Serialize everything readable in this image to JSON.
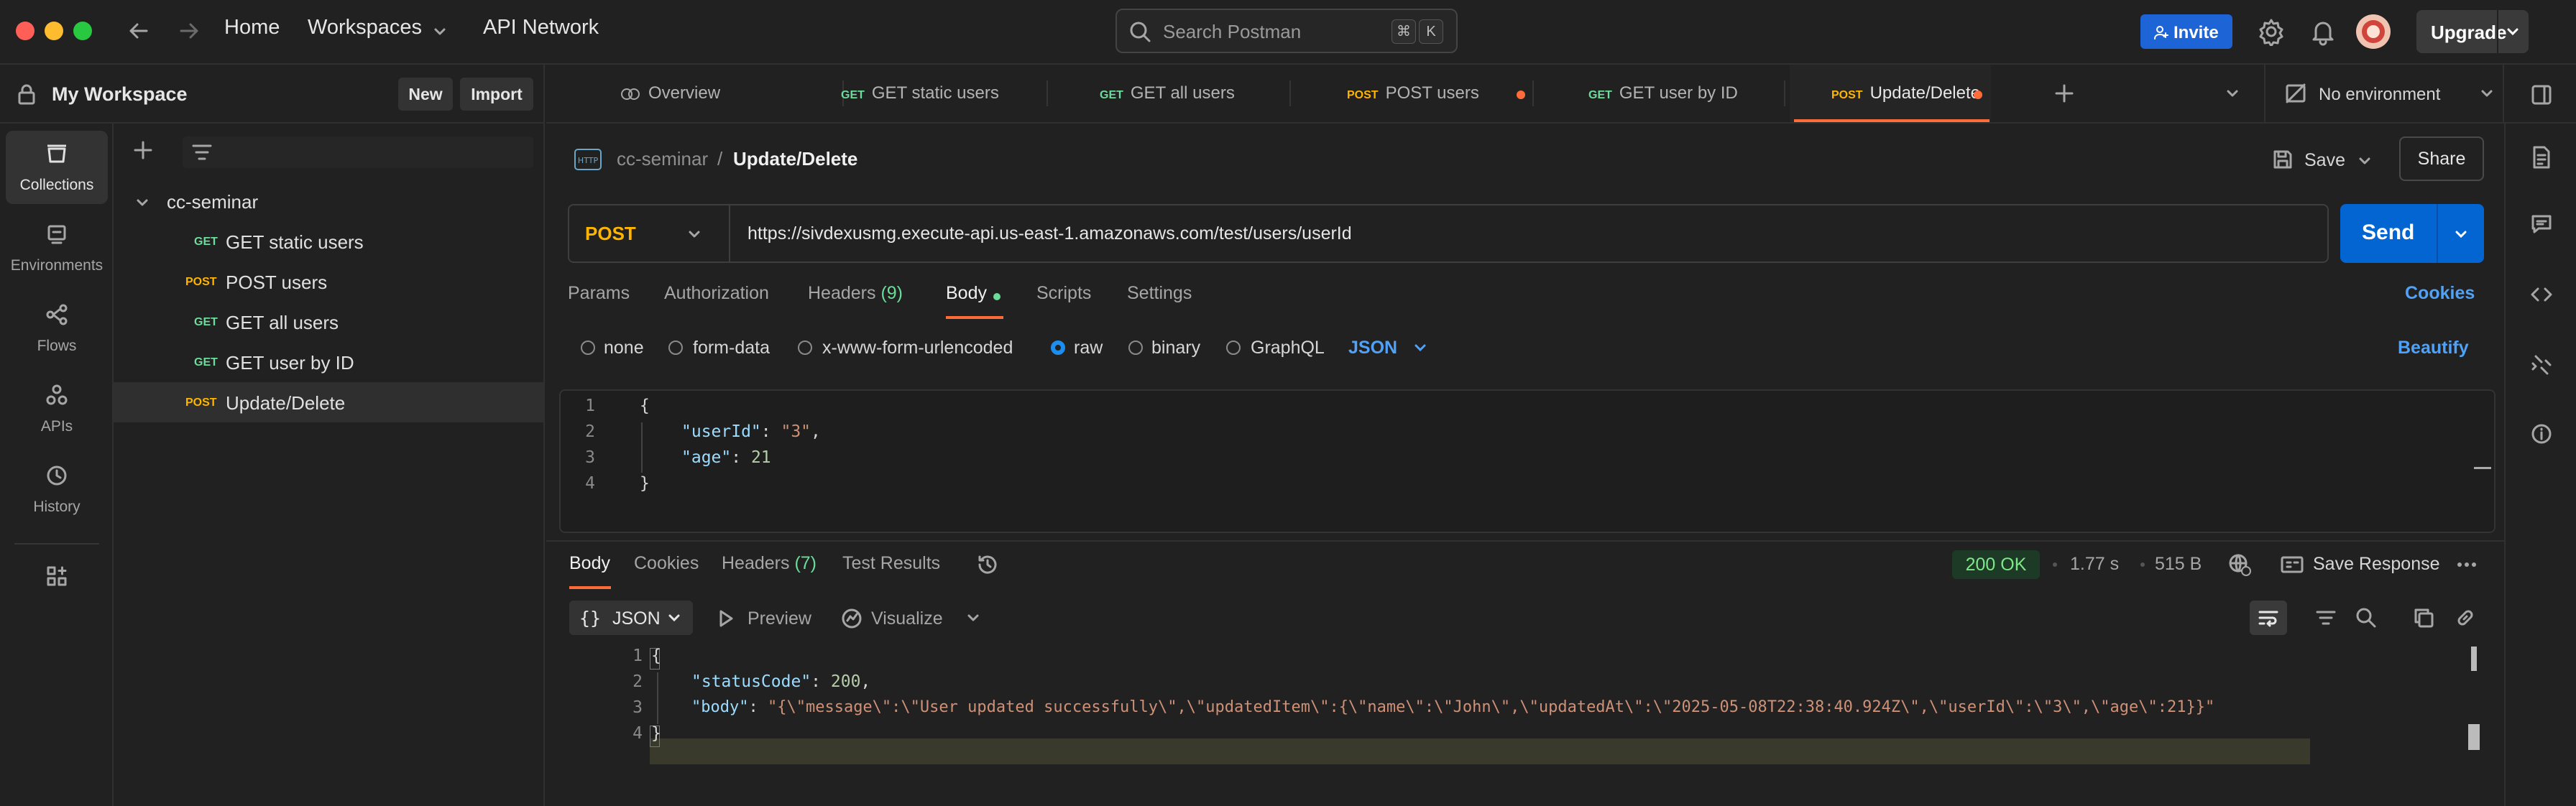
{
  "topbar": {
    "nav_home": "Home",
    "nav_workspaces": "Workspaces",
    "nav_api_network": "API Network",
    "search_placeholder": "Search Postman",
    "kbd_cmd": "⌘",
    "kbd_k": "K",
    "invite_label": "Invite",
    "upgrade_label": "Upgrade"
  },
  "workspace": {
    "name": "My Workspace",
    "new_label": "New",
    "import_label": "Import"
  },
  "sidebar": {
    "items": [
      {
        "label": "Collections",
        "icon": "collections-icon",
        "active": true
      },
      {
        "label": "Environments",
        "icon": "environments-icon"
      },
      {
        "label": "Flows",
        "icon": "flows-icon"
      },
      {
        "label": "APIs",
        "icon": "apis-icon"
      },
      {
        "label": "History",
        "icon": "history-icon"
      }
    ]
  },
  "collection": {
    "name": "cc-seminar",
    "requests": [
      {
        "method": "GET",
        "name": "GET static users"
      },
      {
        "method": "POST",
        "name": "POST users"
      },
      {
        "method": "GET",
        "name": "GET all users"
      },
      {
        "method": "GET",
        "name": "GET user by ID"
      },
      {
        "method": "POST",
        "name": "Update/Delete",
        "selected": true
      }
    ]
  },
  "tabs": [
    {
      "method": "",
      "label": "Overview"
    },
    {
      "method": "GET",
      "label": "GET static users"
    },
    {
      "method": "GET",
      "label": "GET all users"
    },
    {
      "method": "POST",
      "label": "POST users",
      "unsaved": true
    },
    {
      "method": "GET",
      "label": "GET user by ID"
    },
    {
      "method": "POST",
      "label": "Update/Delete",
      "unsaved": true,
      "active": true
    }
  ],
  "environment": "No environment",
  "request": {
    "breadcrumb_collection": "cc-seminar",
    "breadcrumb_separator": "/",
    "breadcrumb_request": "Update/Delete",
    "save_label": "Save",
    "share_label": "Share",
    "method": "POST",
    "url": "https://sivdexusmg.execute-api.us-east-1.amazonaws.com/test/users/userId",
    "send_label": "Send",
    "tabs": {
      "params": "Params",
      "authorization": "Authorization",
      "headers": "Headers",
      "headers_count": "(9)",
      "body": "Body",
      "scripts": "Scripts",
      "settings": "Settings"
    },
    "cookies_label": "Cookies",
    "body_modes": [
      "none",
      "form-data",
      "x-www-form-urlencoded",
      "raw",
      "binary",
      "GraphQL"
    ],
    "selected_mode": "raw",
    "format": "JSON",
    "beautify_label": "Beautify",
    "body_lines": {
      "l1_num": "1",
      "l2_num": "2",
      "l3_num": "3",
      "l4_num": "4",
      "l1": "{",
      "l2_key": "\"userId\"",
      "l2_colon": ": ",
      "l2_val": "\"3\"",
      "l2_comma": ",",
      "l3_key": "\"age\"",
      "l3_colon": ": ",
      "l3_val": "21",
      "l4": "}"
    }
  },
  "response": {
    "tabs": {
      "body": "Body",
      "cookies": "Cookies",
      "headers": "Headers",
      "headers_count": "(7)",
      "test_results": "Test Results"
    },
    "status": "200 OK",
    "time": "1.77 s",
    "size": "515 B",
    "save_response_label": "Save Response",
    "format_label": "JSON",
    "format_braces": "{}",
    "preview_label": "Preview",
    "visualize_label": "Visualize",
    "body_lines": {
      "l1_num": "1",
      "l2_num": "2",
      "l3_num": "3",
      "l4_num": "4",
      "l1": "{",
      "l2_key": "\"statusCode\"",
      "l2_colon": ": ",
      "l2_val": "200",
      "l2_comma": ",",
      "l3_key": "\"body\"",
      "l3_colon": ": ",
      "l3_val": "\"{\\\"message\\\":\\\"User updated successfully\\\",\\\"updatedItem\\\":{\\\"name\\\":\\\"John\\\",\\\"updatedAt\\\":\\\"2025-05-08T22:38:40.924Z\\\",\\\"userId\\\":\\\"3\\\",\\\"age\\\":21}}\"",
      "l4": "}"
    }
  },
  "colors": {
    "accent": "#ff6c37",
    "send_blue": "#0265d2",
    "invite_blue": "#1d64d6",
    "get_green": "#6bdd9a",
    "post_yellow": "#ffb400",
    "status_green": "#7ee787"
  }
}
